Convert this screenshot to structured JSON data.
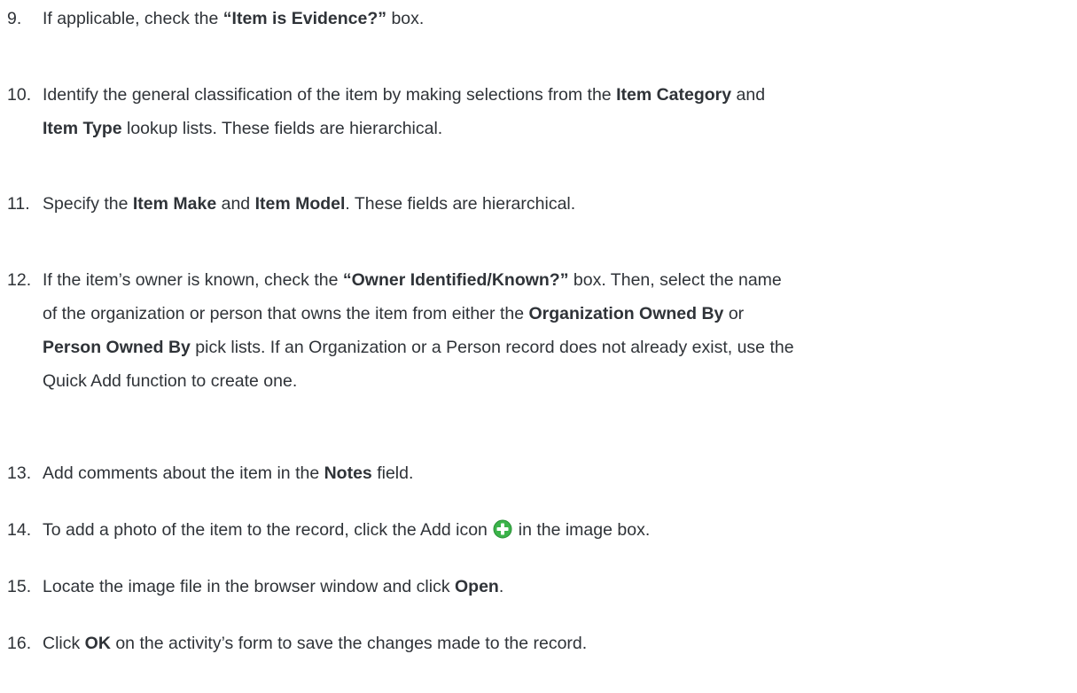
{
  "steps": [
    {
      "number": "9.",
      "lines": [
        [
          {
            "t": "If applicable, check the "
          },
          {
            "b": "“Item is Evidence?”"
          },
          {
            "t": " box."
          }
        ]
      ]
    },
    {
      "number": "10.",
      "lines": [
        [
          {
            "t": "Identify the general classification of the item by making selections from the "
          },
          {
            "b": "Item Category"
          },
          {
            "t": " and"
          }
        ],
        [
          {
            "b": "Item Type"
          },
          {
            "t": " lookup lists. These fields are hierarchical."
          }
        ]
      ]
    },
    {
      "number": "11.",
      "lines": [
        [
          {
            "t": "Specify the "
          },
          {
            "b": "Item Make"
          },
          {
            "t": " and "
          },
          {
            "b": "Item Model"
          },
          {
            "t": ". These fields are hierarchical."
          }
        ]
      ]
    },
    {
      "number": "12.",
      "lines": [
        [
          {
            "t": "If the item’s owner is known, check the "
          },
          {
            "b": "“Owner Identified/Known?”"
          },
          {
            "t": " box. Then, select the name"
          }
        ],
        [
          {
            "t": "of the organization or person that owns the item from either the "
          },
          {
            "b": "Organization Owned By"
          },
          {
            "t": " or"
          }
        ],
        [
          {
            "b": "Person Owned By"
          },
          {
            "t": " pick lists. If an Organization or a Person record does not already exist, use the"
          }
        ],
        [
          {
            "t": "Quick Add function to create one."
          }
        ]
      ]
    },
    {
      "number": "13.",
      "lines": [
        [
          {
            "t": "Add comments about the item in the "
          },
          {
            "b": "Notes"
          },
          {
            "t": " field."
          }
        ]
      ]
    },
    {
      "number": "14.",
      "lines": [
        [
          {
            "t": "To add a photo of the item to the record, click the Add icon "
          },
          {
            "icon": "add-icon"
          },
          {
            "t": " in the image box."
          }
        ]
      ]
    },
    {
      "number": "15.",
      "lines": [
        [
          {
            "t": "Locate the image file in the browser window and click "
          },
          {
            "b": "Open"
          },
          {
            "t": "."
          }
        ]
      ]
    },
    {
      "number": "16.",
      "lines": [
        [
          {
            "t": "Click "
          },
          {
            "b": "OK"
          },
          {
            "t": " on the activity’s form to save the changes made to the record."
          }
        ]
      ]
    }
  ],
  "colors": {
    "text": "#2f3338",
    "add_icon_green": "#3bb34a",
    "background": "#ffffff"
  }
}
